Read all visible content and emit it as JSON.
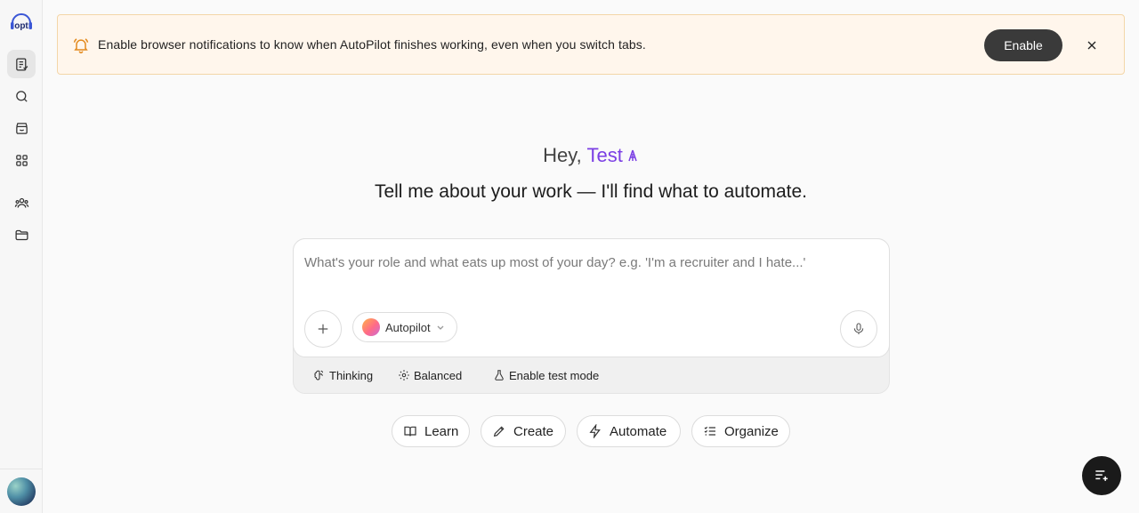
{
  "sidebar": {
    "logo_text": "opt",
    "items": [
      {
        "icon": "tasks-icon",
        "active": true
      },
      {
        "icon": "search-icon",
        "active": false
      },
      {
        "icon": "store-icon",
        "active": false
      },
      {
        "icon": "apps-grid-icon",
        "active": false
      },
      {
        "icon": "team-icon",
        "active": false
      },
      {
        "icon": "folder-icon",
        "active": false
      }
    ]
  },
  "banner": {
    "icon": "bell-icon",
    "text": "Enable browser notifications to know when AutoPilot finishes working, even when you switch tabs.",
    "enable_label": "Enable",
    "accent": "#e38a1e"
  },
  "greeting": {
    "prefix": "Hey, ",
    "name": "Test",
    "name_color": "#7b3fe4"
  },
  "subtitle": "Tell me about your work — I'll find what to automate.",
  "composer": {
    "placeholder": "What's your role and what eats up most of your day? e.g. 'I'm a recruiter and I hate...'",
    "value": "",
    "model_label": "Autopilot",
    "options": {
      "thinking_label": "Thinking",
      "balanced_label": "Balanced",
      "test_mode_label": "Enable test mode"
    }
  },
  "chips": {
    "learn": "Learn",
    "create": "Create",
    "automate": "Automate",
    "organize": "Organize"
  }
}
